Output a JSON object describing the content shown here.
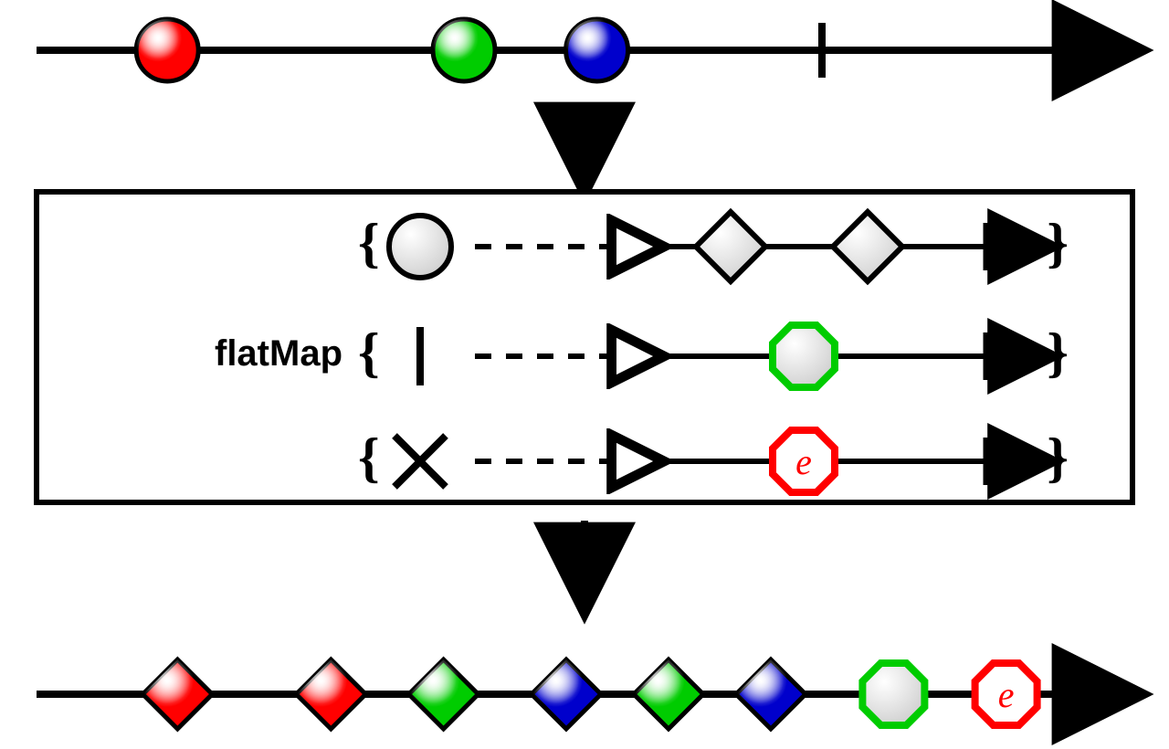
{
  "operator": {
    "name": "flatMap"
  },
  "colors": {
    "red": "#ff0000",
    "green": "#00cc00",
    "blue": "#0000cc",
    "white": "#ffffff"
  },
  "errorLabel": "e",
  "input": {
    "items": [
      {
        "pos": 0.11,
        "color": "red"
      },
      {
        "pos": 0.4,
        "color": "green"
      },
      {
        "pos": 0.53,
        "color": "blue"
      }
    ],
    "completeAt": 0.75
  },
  "operatorBox": {
    "rows": [
      {
        "kind": "next",
        "emits": 2
      },
      {
        "kind": "complete",
        "emits": 1
      },
      {
        "kind": "error",
        "emits": 1
      }
    ]
  },
  "output": {
    "items": [
      {
        "pos": 0.12,
        "shape": "diamond",
        "color": "red"
      },
      {
        "pos": 0.27,
        "shape": "diamond",
        "color": "red"
      },
      {
        "pos": 0.38,
        "shape": "diamond",
        "color": "green"
      },
      {
        "pos": 0.5,
        "shape": "diamond",
        "color": "blue"
      },
      {
        "pos": 0.6,
        "shape": "diamond",
        "color": "green"
      },
      {
        "pos": 0.7,
        "shape": "diamond",
        "color": "blue"
      },
      {
        "pos": 0.82,
        "shape": "octagon",
        "color": "white",
        "stroke": "green"
      }
    ],
    "errorAt": 0.93,
    "errorLabel": "e"
  }
}
